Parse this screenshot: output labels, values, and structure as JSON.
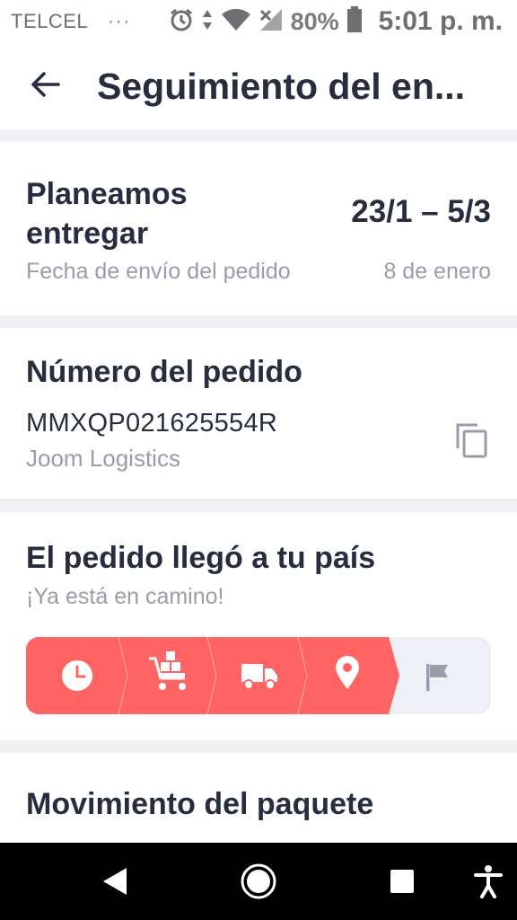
{
  "status_bar": {
    "carrier": "TELCEL",
    "dots": "···",
    "battery": "80%",
    "time": "5:01 p. m.",
    "icons": [
      "alarm-icon",
      "data-arrows-icon",
      "wifi-icon",
      "signal-off-icon",
      "battery-icon"
    ]
  },
  "app_bar": {
    "back_icon": "arrow-left-icon",
    "title": "Seguimiento del en..."
  },
  "delivery": {
    "plan_label": "Planeamos entregar",
    "range": "23/1 – 5/3",
    "ship_label": "Fecha de envío del pedido",
    "ship_date": "8 de enero"
  },
  "order": {
    "heading": "Número del pedido",
    "number": "MMXQP021625554R",
    "carrier": "Joom Logistics",
    "copy_icon": "copy-icon"
  },
  "shipment_status": {
    "heading": "El pedido llegó a tu país",
    "subtitle": "¡Ya está en camino!",
    "steps": [
      {
        "icon": "clock-icon",
        "completed": true
      },
      {
        "icon": "warehouse-cart-icon",
        "completed": true
      },
      {
        "icon": "truck-icon",
        "completed": true
      },
      {
        "icon": "location-pin-icon",
        "completed": true
      },
      {
        "icon": "flag-icon",
        "completed": false
      }
    ],
    "colors": {
      "completed": "#ff6363",
      "pending": "#eff0f5",
      "pending_icon": "#9a9cab"
    }
  },
  "movement": {
    "heading": "Movimiento del paquete"
  },
  "nav_bar": {
    "icons": [
      "back-triangle-icon",
      "home-circle-icon",
      "recents-square-icon",
      "accessibility-icon"
    ]
  }
}
